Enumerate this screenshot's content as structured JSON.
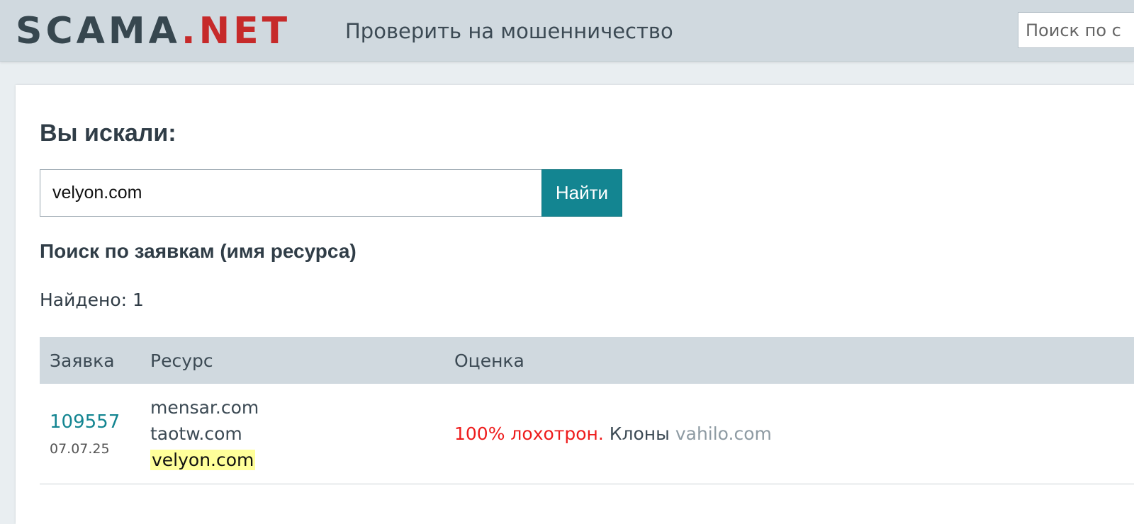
{
  "header": {
    "logo_part1": "SCAMA",
    "logo_part2": ".NET",
    "nav_link": "Проверить на мошенничество",
    "search_placeholder": "Поиск по с"
  },
  "main": {
    "title": "Вы искали:",
    "search_value": "velyon.com",
    "search_button": "Найти",
    "section_title": "Поиск по заявкам (имя ресурса)",
    "found_text": "Найдено: 1",
    "table": {
      "headers": [
        "Заявка",
        "Ресурс",
        "Оценка"
      ],
      "rows": [
        {
          "id": "109557",
          "date": "07.07.25",
          "resources": [
            "mensar.com",
            "taotw.com",
            "velyon.com"
          ],
          "highlighted_resource": "velyon.com",
          "verdict": "100% лохотрон.",
          "clones_label": " Клоны ",
          "clone_link": "vahilo.com"
        }
      ]
    }
  },
  "colors": {
    "accent": "#138591",
    "logo_dark": "#37474f",
    "logo_red": "#c62a2a",
    "verdict_red": "#ee1c1c",
    "highlight": "#ffff9a",
    "header_bg": "#d0d9df"
  }
}
